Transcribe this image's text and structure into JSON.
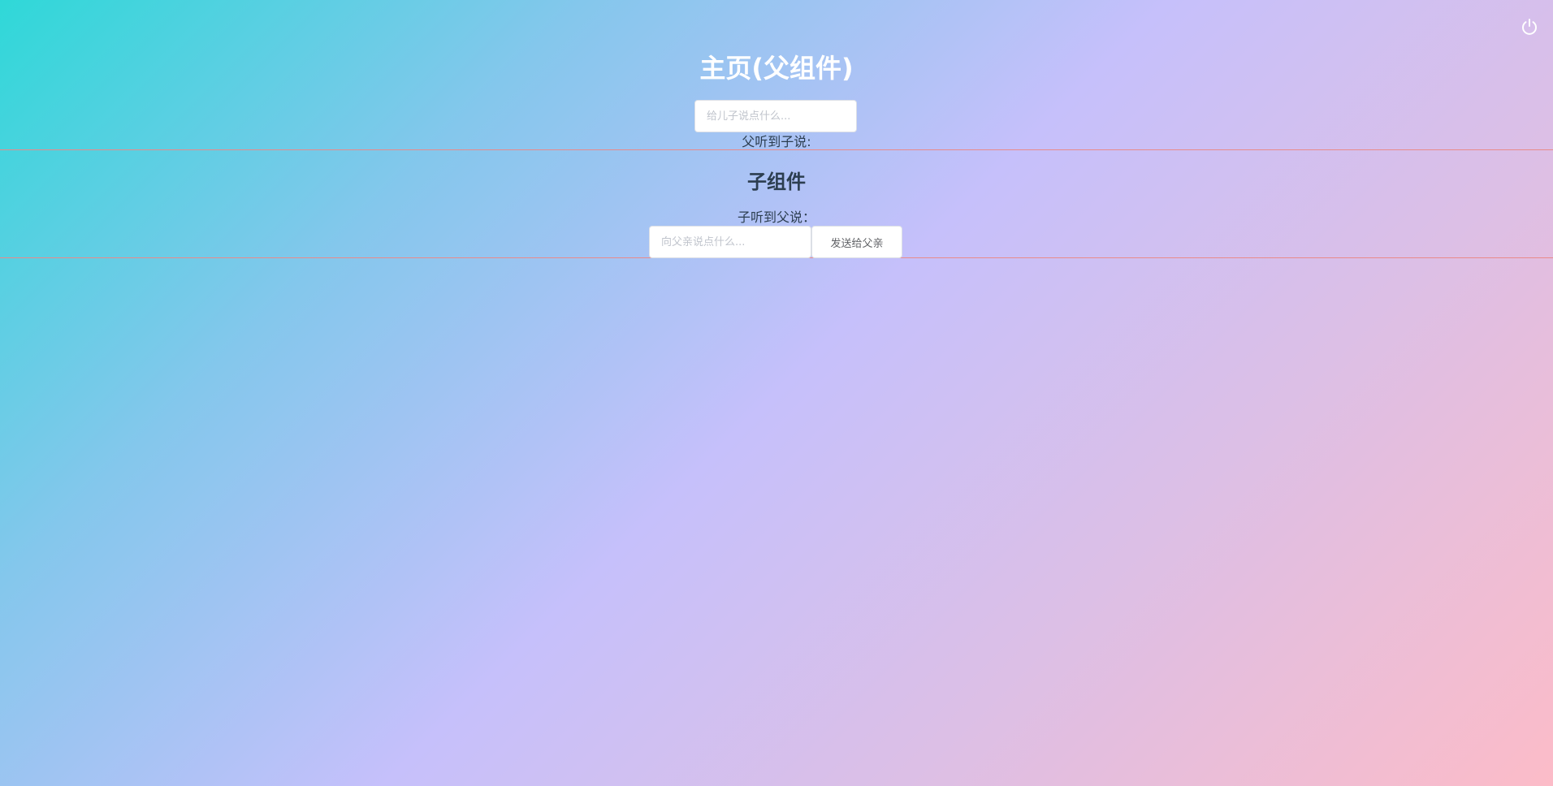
{
  "header": {
    "power_icon": "power-icon",
    "icon_color": "#ffffff"
  },
  "parent": {
    "title": "主页(父组件)",
    "input_placeholder": "给儿子说点什么...",
    "input_value": "",
    "heard_label": "父听到子说:",
    "heard_value": ""
  },
  "child": {
    "title": "子组件",
    "heard_label": "子听到父说：",
    "heard_value": "",
    "input_placeholder": "向父亲说点什么...",
    "input_value": "",
    "send_button_label": "发送给父亲"
  },
  "colors": {
    "gradient_start": "#2fd8d8",
    "gradient_mid": "#c6c0fb",
    "gradient_end": "#fcbcc8",
    "divider": "#e98a8a",
    "title_color": "#ffffff",
    "text_color": "#2c3e50"
  }
}
